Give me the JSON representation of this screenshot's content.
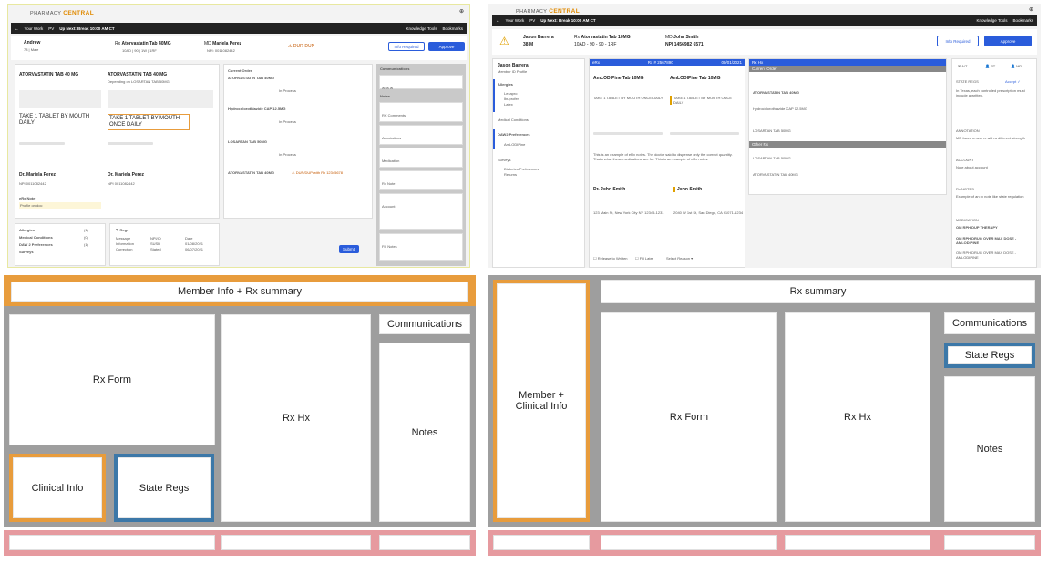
{
  "colors": {
    "brand_orange": "#e08a00",
    "accent_blue": "#2a5cdb",
    "wf_orange": "#e89c3c",
    "wf_blue": "#3c78a8",
    "wf_pink": "#e69a9f",
    "wf_grey": "#9e9e9e",
    "nav_dark": "#222222"
  },
  "left_screen": {
    "brand_prefix": "PHARMACY",
    "brand_name": "CENTRAL",
    "nav": {
      "back": "←",
      "your_work": "Your Work",
      "pv": "PV",
      "up_next": "Up Next: Break 10:00 AM CT",
      "knowledge_tools": "Knowledge Tools",
      "bookmarks": "Bookmarks"
    },
    "member": {
      "name": "Andrew",
      "sub": "78 | Male",
      "rx_prefix": "Rx",
      "rx_name": "Atorvastatin Tab 40MG",
      "rx_sub": "10AD | 90 | 1W | 1RF",
      "md_prefix": "MD",
      "md_name": "Mariela Perez",
      "md_sub": "NPI: 0011082442",
      "dur": "DUR-DUP",
      "info_required": "Info Required",
      "approve": "Approve"
    },
    "rx_form": {
      "left_title": "ATORVASTATIN TAB 40 MG",
      "right_title": "ATORVASTATIN TAB 40 MG",
      "right_sub": "Depending on LOSARTAN TAB 50MG",
      "left_sig": "TAKE 1 TABLET BY MOUTH DAILY",
      "right_sig": "TAKE 1 TABLET BY MOUTH ONCE DAILY",
      "left_doc": "Dr. Mariela Perez",
      "right_doc": "Dr. Mariela Perez",
      "left_npi": "NPI 0011082442",
      "right_npi": "NPI 0011082442",
      "erx_label": "eRx Note",
      "erx_note": "Profile on doc"
    },
    "rx_hx": {
      "title": "Current Order",
      "items": [
        "ATORVASTATIN TAB 40MG",
        "Hydrochlorothiazide CAP 12.5MG",
        "LOSARTAN TAB 50MG",
        "ATORVASTATIN TAB 40MG"
      ],
      "dur_flag": "DUR/DUP with Rx 12345678",
      "status": "In Process"
    },
    "notes": {
      "communications": "Communications",
      "notes": "Notes",
      "items": [
        "RX Comments",
        "Annotations",
        "Medication",
        "Rx Note",
        "Account",
        "Fill Notes"
      ]
    },
    "clinical": {
      "rows": [
        "Allergies",
        "Medical Conditions",
        "DAW 2 Preferences",
        "Surveys"
      ],
      "counts": [
        "(1)",
        "(0)",
        "(1)",
        ""
      ]
    },
    "state_regs": {
      "title": "Regs",
      "cols": [
        "Message",
        "NPI/ID",
        "Date"
      ],
      "rows": [
        [
          "Information",
          "SUSD",
          "01/08/2021"
        ],
        [
          "Correction",
          "Stated",
          "06/07/2021"
        ]
      ],
      "submit": "Submit"
    }
  },
  "right_screen": {
    "brand_prefix": "PHARMACY",
    "brand_name": "CENTRAL",
    "nav": {
      "back": "←",
      "your_work": "Your Work",
      "pv": "PV",
      "up_next": "Up Next: Break 10:00 AM CT",
      "knowledge_tools": "Knowledge Tools",
      "bookmarks": "Bookmarks"
    },
    "member": {
      "name": "Jason Barrera",
      "sub": "38 M",
      "rx_prefix": "Rx",
      "rx_name": "Atorvastatin Tab 10MG",
      "rx_sub": "10AD - 90 - 90 - 1RF",
      "md_prefix": "MD",
      "md_name": "John Smith",
      "md_sub": "NPI 1456982 6571",
      "info_required": "Info Required",
      "approve": "Approve"
    },
    "sidebar": {
      "name": "Jason Barrera",
      "sub": "Member ID Profile",
      "allergies": "Allergies",
      "allergy_items": [
        "Lexapro",
        "Ibuprofen",
        "Latex"
      ],
      "medical": "Medical Conditions",
      "daw": "DAW2 Preferences",
      "daw_item": "AmLODIPine",
      "surveys": "Surveys",
      "survey_items": [
        "Diabetes Preferences",
        "Returns"
      ]
    },
    "erx_head": "eRx",
    "rx_head": "Rx # 2567890",
    "rx_date": "09/01/2021",
    "form": {
      "left_drug": "AmLODIPine Tab 10MG",
      "right_drug": "AmLODIPine Tab 10MG",
      "left_sig": "TAKE 1 TABLET BY MOUTH ONCE DAILY",
      "right_sig": "TAKE 1 TABLET BY MOUTH ONCE DAILY",
      "note": "This is an example of eRx notes. The doctor said to dispense only the correct quantity. That's what these medications are for. This is an example of eRx notes.",
      "doc_left": "Dr. John Smith",
      "doc_right": "John Smith",
      "left_addr": "123 Main St, New York City NY 12345-1231",
      "right_addr": "2040 W 1st St, San Diego, CA 91071-1234",
      "release": "Release to Written",
      "fill_later": "Fill Later",
      "select_reason": "Select Reason"
    },
    "hx": {
      "head": "Rx Hx",
      "current": "Current Order",
      "other": "Other Rx",
      "items": [
        "ATORVASTATIN TAB 40MG",
        "Hydrochlorothiazide CAP 12.5MG",
        "LOSARTAN TAB 50MG",
        "LOSARTAN TAB 50MG",
        "ATORVASTATIN TAB 40MG"
      ]
    },
    "notes_panel": {
      "tabs": [
        "A/T",
        "PT",
        "MD"
      ],
      "state_regs": "STATE REGS",
      "accept": "Accept ✓",
      "state_text": "In Texas, each controlled prescription must include a written.",
      "annotation": "ANNOTATION",
      "annotation_text": "MD faxed a new rx with a different strength",
      "account": "ACCOUNT",
      "account_text": "Note about account",
      "rx_notes": "Rx NOTES",
      "rx_notes_text": "Example of an rx note like state regulation",
      "medication": "MEDICATION",
      "med_items": [
        "OM RPH DUP THERAPY",
        "OM RPH DRUG OVER MAX DOSE - AMLODIPINE",
        "OM RPH DRUG OVER MAX DOSE - AMLODIPINE"
      ]
    }
  },
  "wireframe_left": {
    "header": "Member Info + Rx summary",
    "rx_form": "Rx Form",
    "rx_hx": "Rx Hx",
    "communications": "Communications",
    "notes": "Notes",
    "clinical": "Clinical Info",
    "state_regs": "State Regs"
  },
  "wireframe_right": {
    "header": "Rx summary",
    "member": "Member +\nClinical Info",
    "rx_form": "Rx Form",
    "rx_hx": "Rx Hx",
    "communications": "Communications",
    "state_regs": "State Regs",
    "notes": "Notes"
  }
}
